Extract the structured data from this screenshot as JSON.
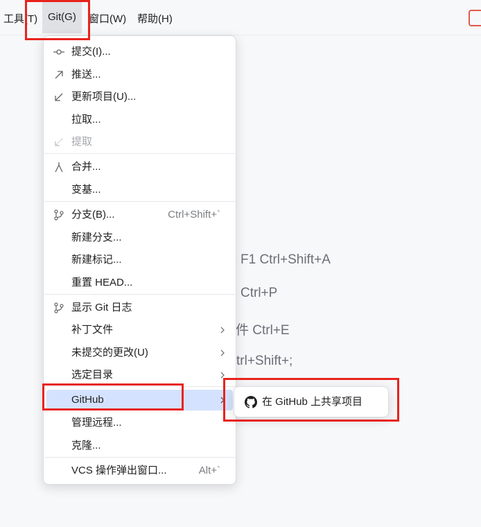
{
  "menubar": {
    "tools": "工具(T)",
    "git": "Git(G)",
    "window": "窗口(W)",
    "help": "帮助(H)"
  },
  "background_hints": {
    "line1": "F1 Ctrl+Shift+A",
    "line2": "Ctrl+P",
    "line3": "件 Ctrl+E",
    "line4": "trl+Shift+;"
  },
  "git_menu": {
    "items": [
      {
        "label": "提交(I)...",
        "icon": "commit-icon"
      },
      {
        "label": "推送...",
        "icon": "push-arrow-icon"
      },
      {
        "label": "更新项目(U)...",
        "icon": "update-arrow-icon"
      },
      {
        "label": "拉取..."
      },
      {
        "label": "提取",
        "icon": "fetch-icon",
        "disabled": true
      },
      {
        "label": "合并...",
        "icon": "merge-icon"
      },
      {
        "label": "变基..."
      },
      {
        "label": "分支(B)...",
        "icon": "branch-icon",
        "shortcut": "Ctrl+Shift+`"
      },
      {
        "label": "新建分支..."
      },
      {
        "label": "新建标记..."
      },
      {
        "label": "重置 HEAD..."
      },
      {
        "label": "显示 Git 日志",
        "icon": "git-log-icon"
      },
      {
        "label": "补丁文件",
        "submenu": true
      },
      {
        "label": "未提交的更改(U)",
        "submenu": true
      },
      {
        "label": "选定目录",
        "submenu": true
      },
      {
        "label": "GitHub",
        "submenu": true,
        "selected": true
      },
      {
        "label": "管理远程..."
      },
      {
        "label": "克隆..."
      },
      {
        "label": "VCS 操作弹出窗口...",
        "shortcut": "Alt+`"
      }
    ]
  },
  "github_submenu": {
    "share_label": "在 GitHub 上共享项目",
    "icon": "github-icon"
  },
  "colors": {
    "selected_bg": "#d4e2ff",
    "highlight_border": "#e8231c"
  }
}
